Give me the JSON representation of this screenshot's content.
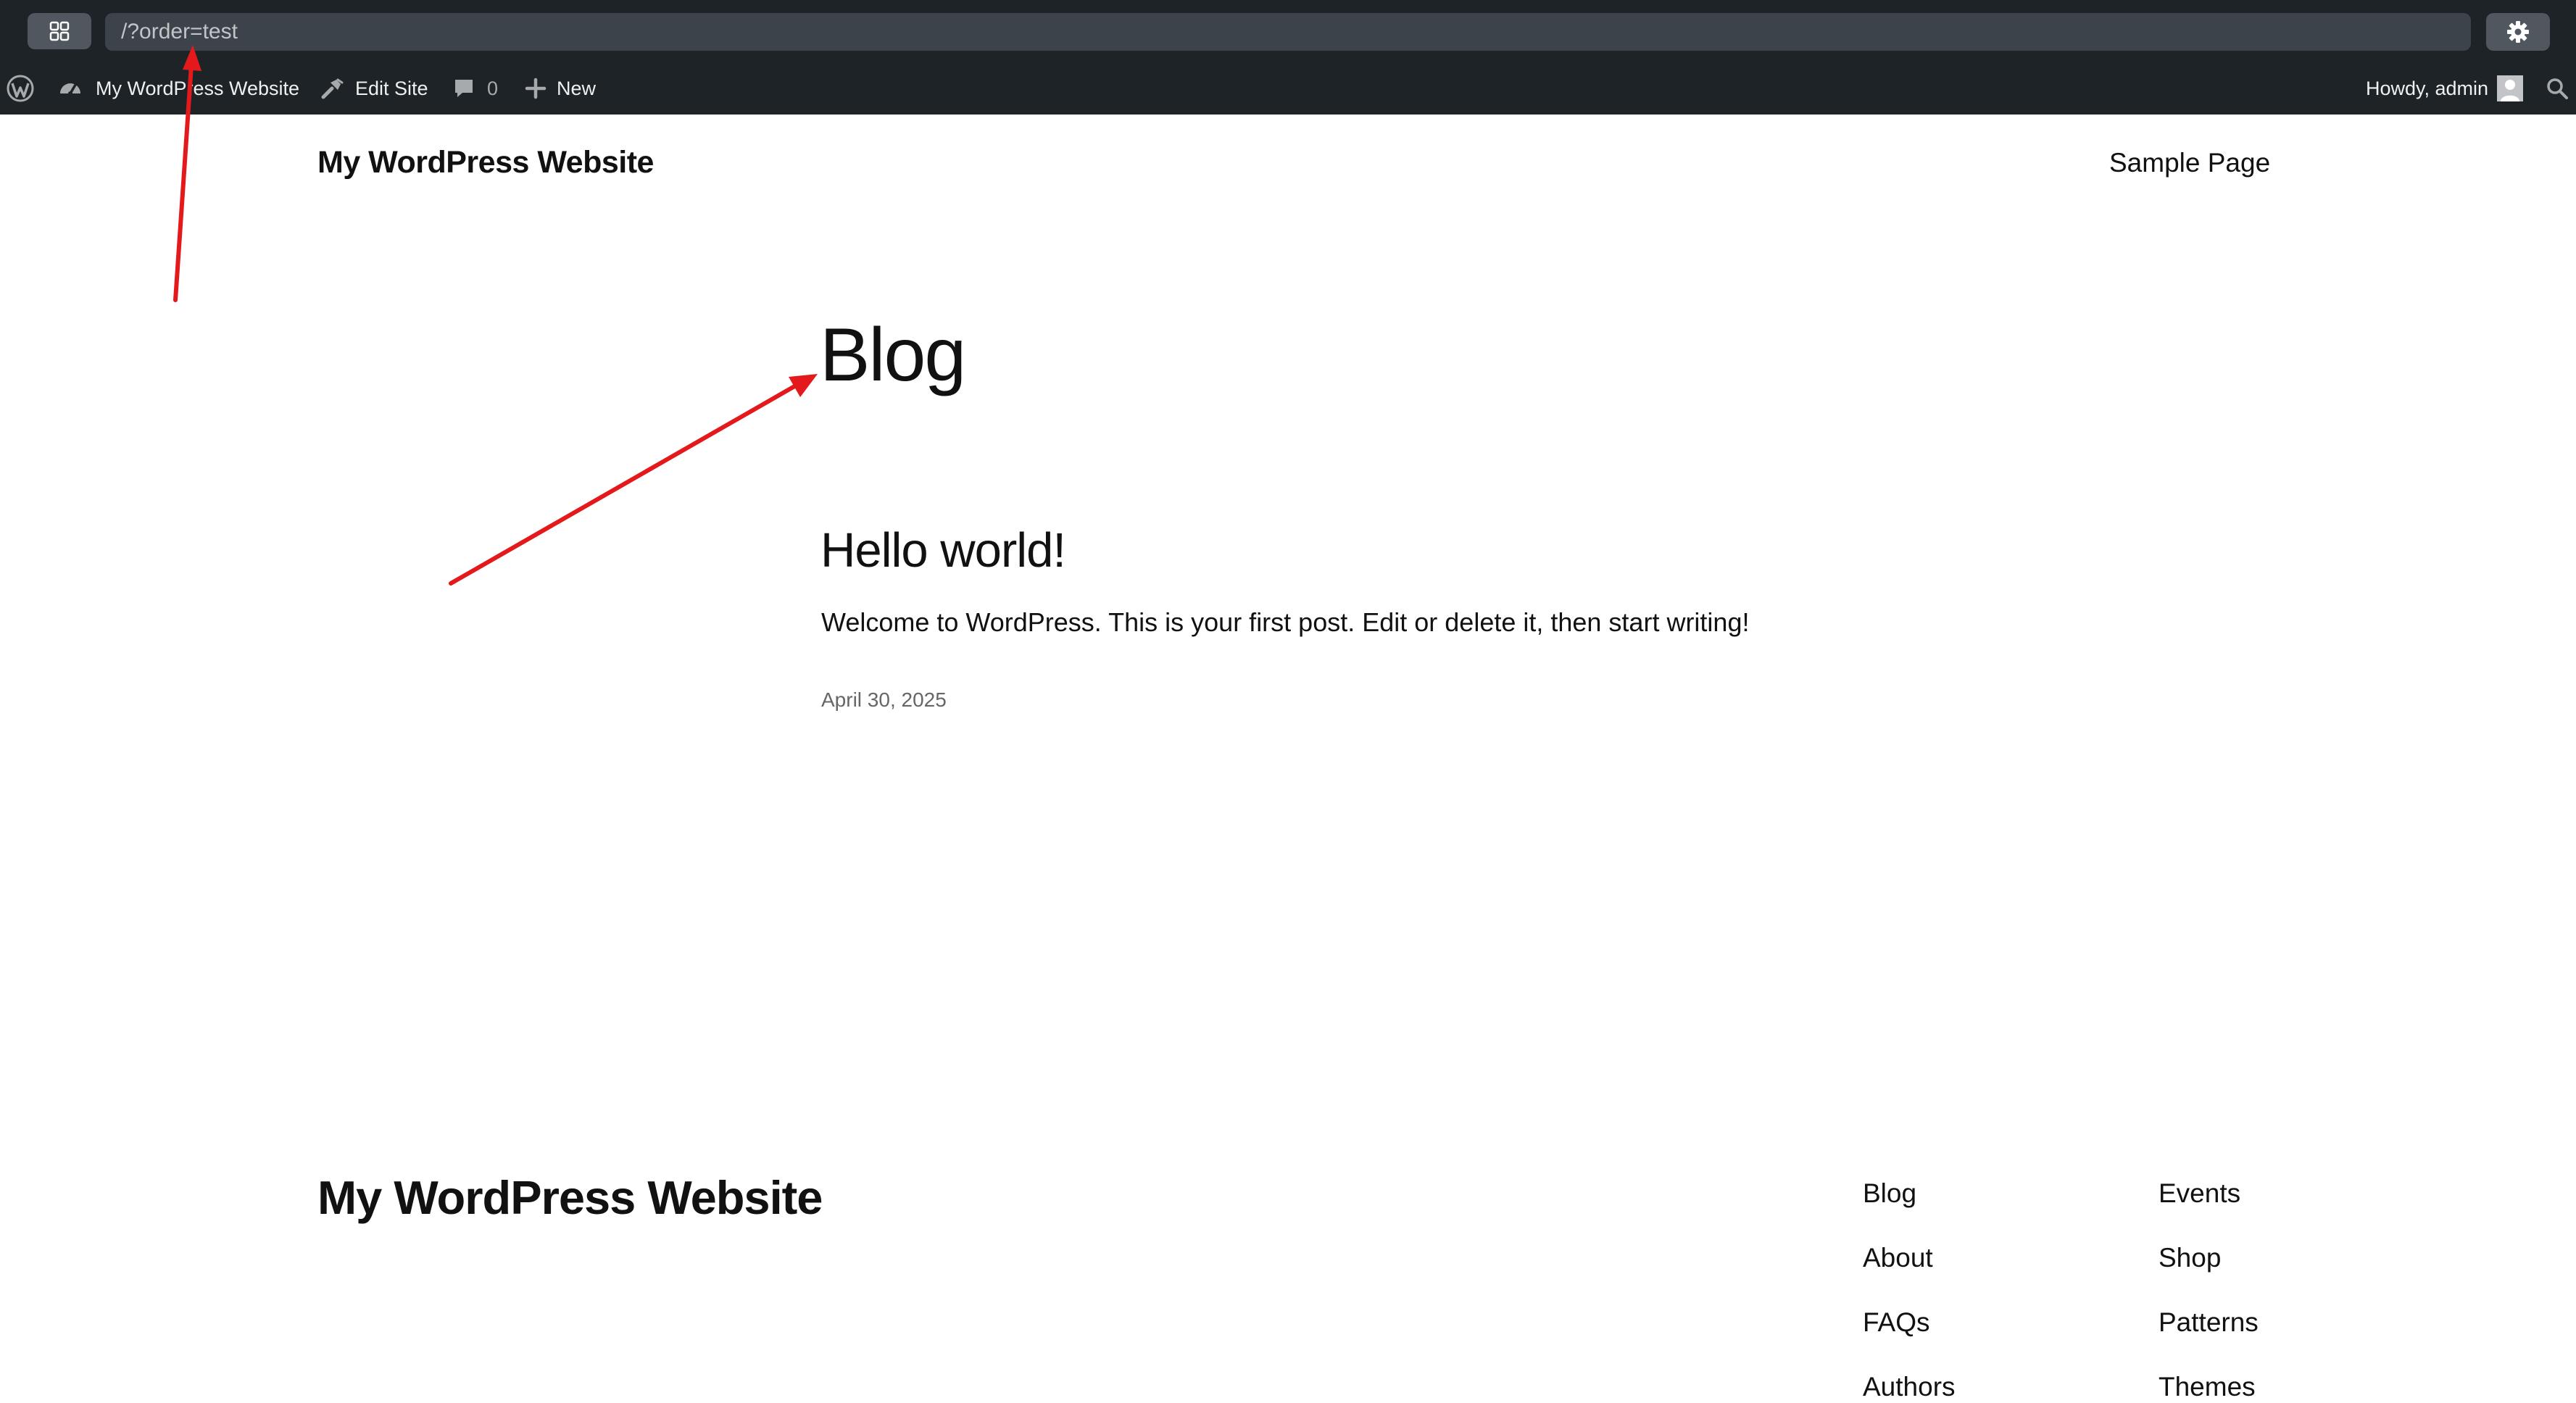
{
  "browser": {
    "url": "/?order=test"
  },
  "admin_bar": {
    "site_name": "My WordPress Website",
    "edit_site": "Edit Site",
    "comments_count": "0",
    "new_label": "New",
    "greeting": "Howdy, admin"
  },
  "header": {
    "site_title": "My WordPress Website",
    "nav": [
      "Sample Page"
    ]
  },
  "main": {
    "heading": "Blog",
    "post": {
      "title": "Hello world!",
      "excerpt": "Welcome to WordPress. This is your first post. Edit or delete it, then start writing!",
      "date": "April 30, 2025"
    }
  },
  "footer": {
    "site_title": "My WordPress Website",
    "col1": [
      "Blog",
      "About",
      "FAQs",
      "Authors"
    ],
    "col2": [
      "Events",
      "Shop",
      "Patterns",
      "Themes"
    ]
  },
  "colors": {
    "toolbar_bg": "#1e2327",
    "annotation": "#e3191c"
  },
  "icons": [
    "grid-icon",
    "gear-icon",
    "wordpress-logo-icon",
    "dashboard-icon",
    "brush-icon",
    "comment-icon",
    "plus-icon",
    "avatar",
    "search-icon"
  ]
}
